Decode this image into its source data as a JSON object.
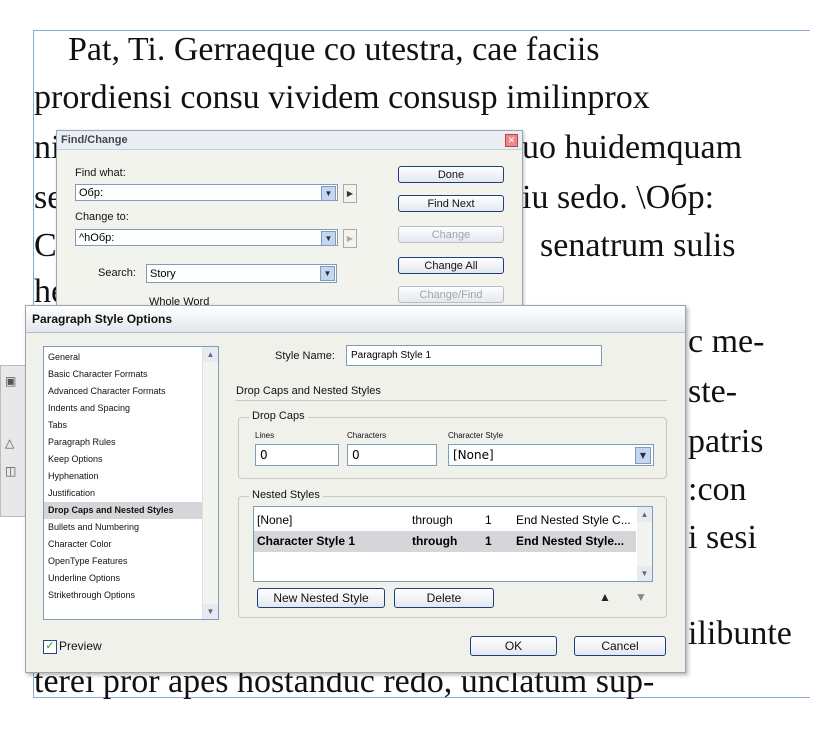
{
  "document": {
    "lines": [
      "    Pat, Ti. Gerraeque co utestra, cae faciis",
      "prordiensi consu vividem consusp imilinprox",
      "ni",
      "se",
      "C",
      "he"
    ],
    "right_fragments": [
      "uo huidemquam",
      "iu sedo. \\Обр:",
      "senatrum sulis",
      "c me-",
      "ste-",
      "patris",
      ":con",
      "i sesi",
      "ilibunte"
    ],
    "bottom_line": "terei pror apes hostanduc redo, unclatum sup-"
  },
  "find_change": {
    "title": "Find/Change",
    "find_what_label": "Find what:",
    "find_what_value": "Обр:",
    "change_to_label": "Change to:",
    "change_to_value": "^hОбр:",
    "search_label": "Search:",
    "search_value": "Story",
    "whole_word_label": "Whole Word",
    "buttons": {
      "done": "Done",
      "find_next": "Find Next",
      "change": "Change",
      "change_all": "Change All",
      "change_find": "Change/Find"
    }
  },
  "paragraph_style_options": {
    "title": "Paragraph Style Options",
    "categories": [
      "General",
      "Basic Character Formats",
      "Advanced Character Formats",
      "Indents and Spacing",
      "Tabs",
      "Paragraph Rules",
      "Keep Options",
      "Hyphenation",
      "Justification",
      "Drop Caps and Nested Styles",
      "Bullets and Numbering",
      "Character Color",
      "OpenType Features",
      "Underline Options",
      "Strikethrough Options"
    ],
    "selected_category": "Drop Caps and Nested Styles",
    "style_name_label": "Style Name:",
    "style_name_value": "Paragraph Style 1",
    "section_title": "Drop Caps and Nested Styles",
    "drop_caps": {
      "legend": "Drop Caps",
      "lines_label": "Lines",
      "lines_value": "0",
      "characters_label": "Characters",
      "characters_value": "0",
      "character_style_label": "Character Style",
      "character_style_value": "[None]"
    },
    "nested_styles": {
      "legend": "Nested Styles",
      "rows": [
        {
          "style": "[None]",
          "mode": "through",
          "count": "1",
          "end": "End Nested Style C..."
        },
        {
          "style": "Character Style 1",
          "mode": "through",
          "count": "1",
          "end": "End Nested Style..."
        }
      ],
      "new_button": "New Nested Style",
      "delete_button": "Delete"
    },
    "preview_label": "Preview",
    "preview_checked": true,
    "ok_label": "OK",
    "cancel_label": "Cancel"
  },
  "colors": {
    "frame_border": "#8aa8d6",
    "selection": "#d4d6da",
    "button_border": "#1f3e7a"
  }
}
